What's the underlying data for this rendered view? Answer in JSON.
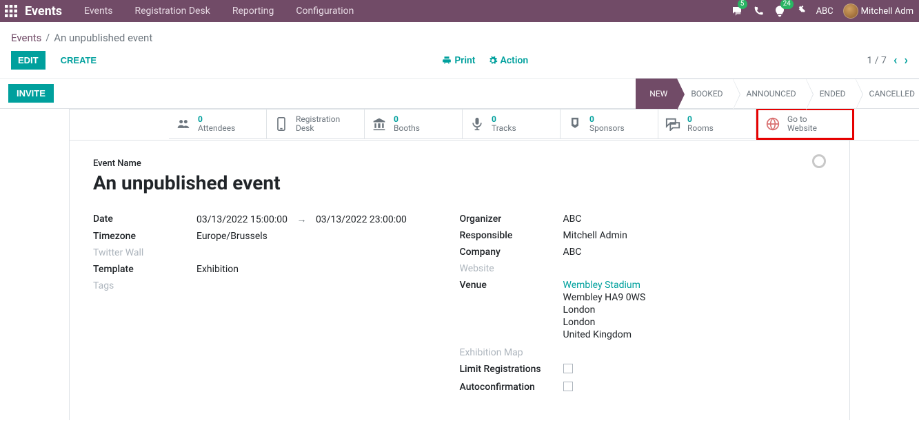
{
  "nav": {
    "app_title": "Events",
    "items": [
      "Events",
      "Registration Desk",
      "Reporting",
      "Configuration"
    ],
    "messages_badge": "5",
    "activities_badge": "24",
    "company": "ABC",
    "user": "Mitchell Adm"
  },
  "breadcrumb": {
    "root": "Events",
    "current": "An unpublished event"
  },
  "buttons": {
    "edit": "EDIT",
    "create": "CREATE",
    "print": "Print",
    "action": "Action",
    "invite": "INVITE"
  },
  "pager": "1 / 7",
  "stages": {
    "items": [
      "NEW",
      "BOOKED",
      "ANNOUNCED",
      "ENDED",
      "CANCELLED"
    ],
    "active_index": 0
  },
  "stats": {
    "attendees": {
      "num": "0",
      "label": "Attendees"
    },
    "regdesk": {
      "label1": "Registration",
      "label2": "Desk"
    },
    "booths": {
      "num": "0",
      "label": "Booths"
    },
    "tracks": {
      "num": "0",
      "label": "Tracks"
    },
    "sponsors": {
      "num": "0",
      "label": "Sponsors"
    },
    "rooms": {
      "num": "0",
      "label": "Rooms"
    },
    "website": {
      "label1": "Go to",
      "label2": "Website"
    }
  },
  "form": {
    "event_name_label": "Event Name",
    "event_name": "An unpublished event",
    "left": {
      "date_label": "Date",
      "date_start": "03/13/2022 15:00:00",
      "date_end": "03/13/2022 23:00:00",
      "timezone_label": "Timezone",
      "timezone": "Europe/Brussels",
      "twitter_label": "Twitter Wall",
      "template_label": "Template",
      "template": "Exhibition",
      "tags_label": "Tags"
    },
    "right": {
      "organizer_label": "Organizer",
      "organizer": "ABC",
      "responsible_label": "Responsible",
      "responsible": "Mitchell Admin",
      "company_label": "Company",
      "company": "ABC",
      "website_label": "Website",
      "venue_label": "Venue",
      "venue_name": "Wembley Stadium",
      "venue_line2": "Wembley HA9 0WS",
      "venue_line3": "London",
      "venue_line4": "London",
      "venue_country": "United Kingdom",
      "exhib_map_label": "Exhibition Map",
      "limit_reg_label": "Limit Registrations",
      "autoconfirm_label": "Autoconfirmation"
    }
  }
}
